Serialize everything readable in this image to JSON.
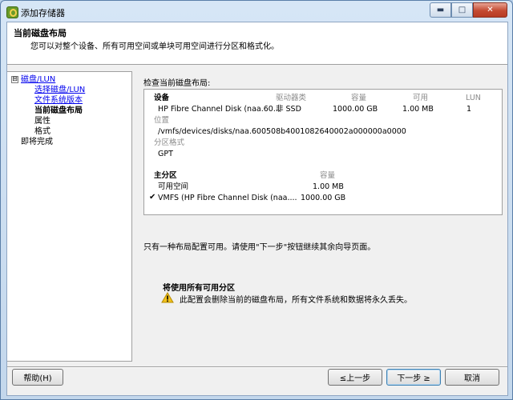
{
  "window": {
    "title": "添加存储器",
    "controls": {
      "minimize": "▬",
      "maximize": "□",
      "close": "✕"
    }
  },
  "header": {
    "title": "当前磁盘布局",
    "subtitle": "您可以对整个设备、所有可用空间或单块可用空间进行分区和格式化。"
  },
  "nav": {
    "toggle": "⊟",
    "items": [
      {
        "label": "磁盘/LUN",
        "state": "link"
      },
      {
        "label": "选择磁盘/LUN",
        "state": "link"
      },
      {
        "label": "文件系统版本",
        "state": "link"
      },
      {
        "label": "当前磁盘布局",
        "state": "current"
      },
      {
        "label": "属性",
        "state": "normal"
      },
      {
        "label": "格式",
        "state": "normal"
      },
      {
        "label": "即将完成",
        "state": "normal"
      }
    ]
  },
  "main": {
    "section_label": "检查当前磁盘布局:",
    "device_table": {
      "headers": {
        "device": "设备",
        "drive_type": "驱动器类",
        "capacity": "容量",
        "available": "可用",
        "lun": "LUN"
      },
      "row": {
        "device": "HP Fibre Channel Disk (naa.60...",
        "drive_type": "非 SSD",
        "capacity": "1000.00 GB",
        "available": "1.00 MB",
        "lun": "1"
      }
    },
    "location_label": "位置",
    "location_value": "/vmfs/devices/disks/naa.600508b4001082640002a000000a0000",
    "partition_format_label": "分区格式",
    "partition_format_value": "GPT",
    "partitions": {
      "header": "主分区",
      "capacity_header": "容量",
      "rows": [
        {
          "check": "",
          "name": "可用空间",
          "capacity": "1.00 MB"
        },
        {
          "check": "✔",
          "name": "VMFS (HP Fibre Channel Disk (naa....",
          "capacity": "1000.00 GB"
        }
      ]
    },
    "note": "只有一种布局配置可用。请使用\"下一步\"按钮继续其余向导页面。",
    "warning": {
      "title": "将使用所有可用分区",
      "text": "此配置会删除当前的磁盘布局，所有文件系统和数据将永久丢失。"
    }
  },
  "footer": {
    "help": "帮助(H)",
    "back": "≤上一步",
    "next": "下一步 ≥",
    "cancel": "取消"
  },
  "colors": {
    "link": "#0000ee",
    "warning_fill": "#f2c21b",
    "default_button_border": "#3c7fb1"
  }
}
